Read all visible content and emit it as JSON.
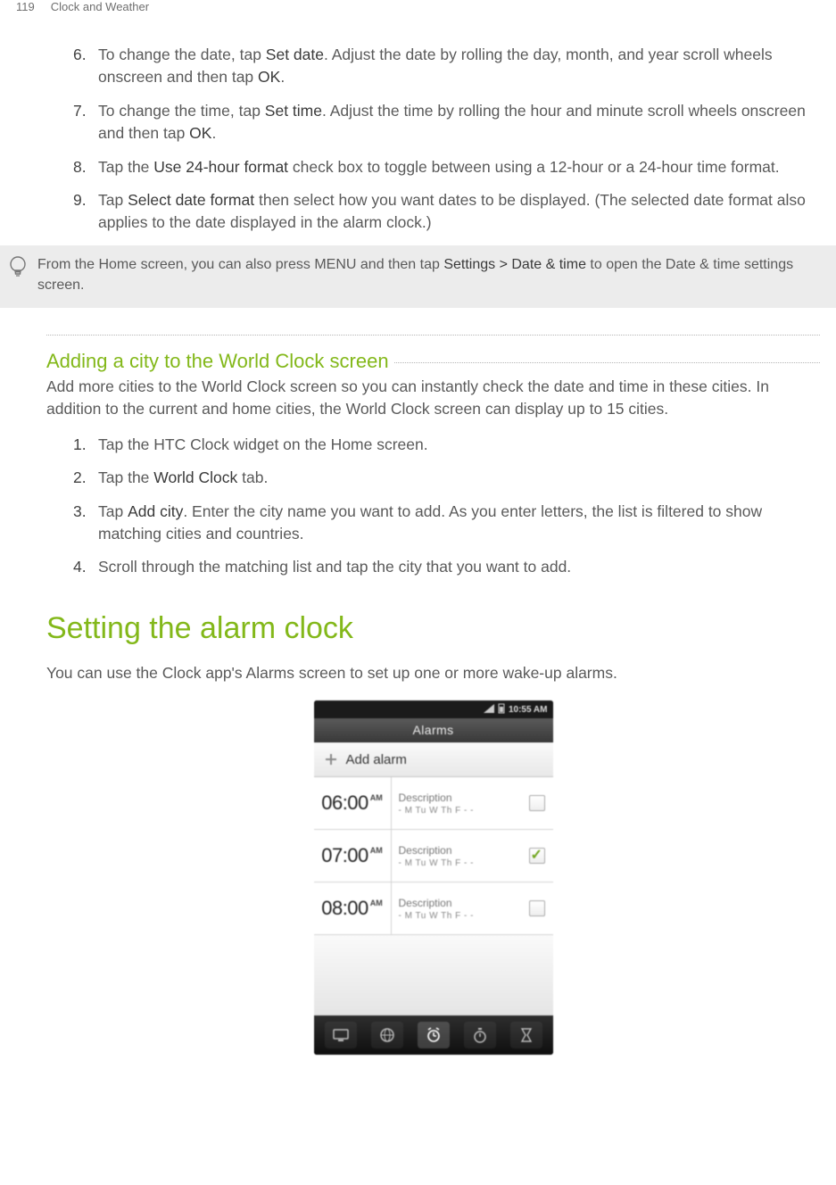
{
  "header": {
    "page_number": "119",
    "chapter": "Clock and Weather"
  },
  "list1": {
    "items": [
      {
        "num": "6.",
        "pre": "To change the date, tap ",
        "term1": "Set date",
        "mid1": ". Adjust the date by rolling the day, month, and year scroll wheels onscreen and then tap ",
        "term2": "OK",
        "post": "."
      },
      {
        "num": "7.",
        "pre": "To change the time, tap ",
        "term1": "Set time",
        "mid1": ". Adjust the time by rolling the hour and minute scroll wheels onscreen and then tap ",
        "term2": "OK",
        "post": "."
      },
      {
        "num": "8.",
        "pre": "Tap the ",
        "term1": "Use 24-hour format",
        "mid1": " check box to toggle between using a 12-hour or a 24-hour time format.",
        "term2": "",
        "post": ""
      },
      {
        "num": "9.",
        "pre": "Tap ",
        "term1": "Select date format",
        "mid1": " then select how you want dates to be displayed. (The selected date format also applies to the date displayed in the alarm clock.)",
        "term2": "",
        "post": ""
      }
    ]
  },
  "tip": {
    "pre": "From the Home screen, you can also press MENU and then tap ",
    "term": "Settings > Date & time",
    "post": " to open the Date & time settings screen."
  },
  "sub_heading": "Adding a city to the World Clock screen",
  "sub_para": "Add more cities to the World Clock screen so you can instantly check the date and time in these cities. In addition to the current and home cities, the World Clock screen can display up to 15 cities.",
  "list2": {
    "items": [
      {
        "num": "1.",
        "pre": "Tap the HTC Clock widget on the Home screen.",
        "term1": "",
        "mid1": "",
        "term2": "",
        "post": ""
      },
      {
        "num": "2.",
        "pre": "Tap the ",
        "term1": "World Clock",
        "mid1": " tab.",
        "term2": "",
        "post": ""
      },
      {
        "num": "3.",
        "pre": "Tap ",
        "term1": "Add city",
        "mid1": ". Enter the city name you want to add. As you enter letters, the list is filtered to show matching cities and countries.",
        "term2": "",
        "post": ""
      },
      {
        "num": "4.",
        "pre": "Scroll through the matching list and tap the city that you want to add.",
        "term1": "",
        "mid1": "",
        "term2": "",
        "post": ""
      }
    ]
  },
  "big_heading": "Setting the alarm clock",
  "big_para": "You can use the Clock app's Alarms screen to set up one or more wake-up alarms.",
  "phone": {
    "status_time": "10:55 AM",
    "topbar": "Alarms",
    "add_label": "Add alarm",
    "rows": [
      {
        "time": "06:00",
        "ampm": "AM",
        "desc": "Description",
        "days": "- M Tu W Th F - -",
        "checked": false
      },
      {
        "time": "07:00",
        "ampm": "AM",
        "desc": "Description",
        "days": "- M Tu W Th F - -",
        "checked": true
      },
      {
        "time": "08:00",
        "ampm": "AM",
        "desc": "Description",
        "days": "- M Tu W Th F - -",
        "checked": false
      }
    ]
  }
}
